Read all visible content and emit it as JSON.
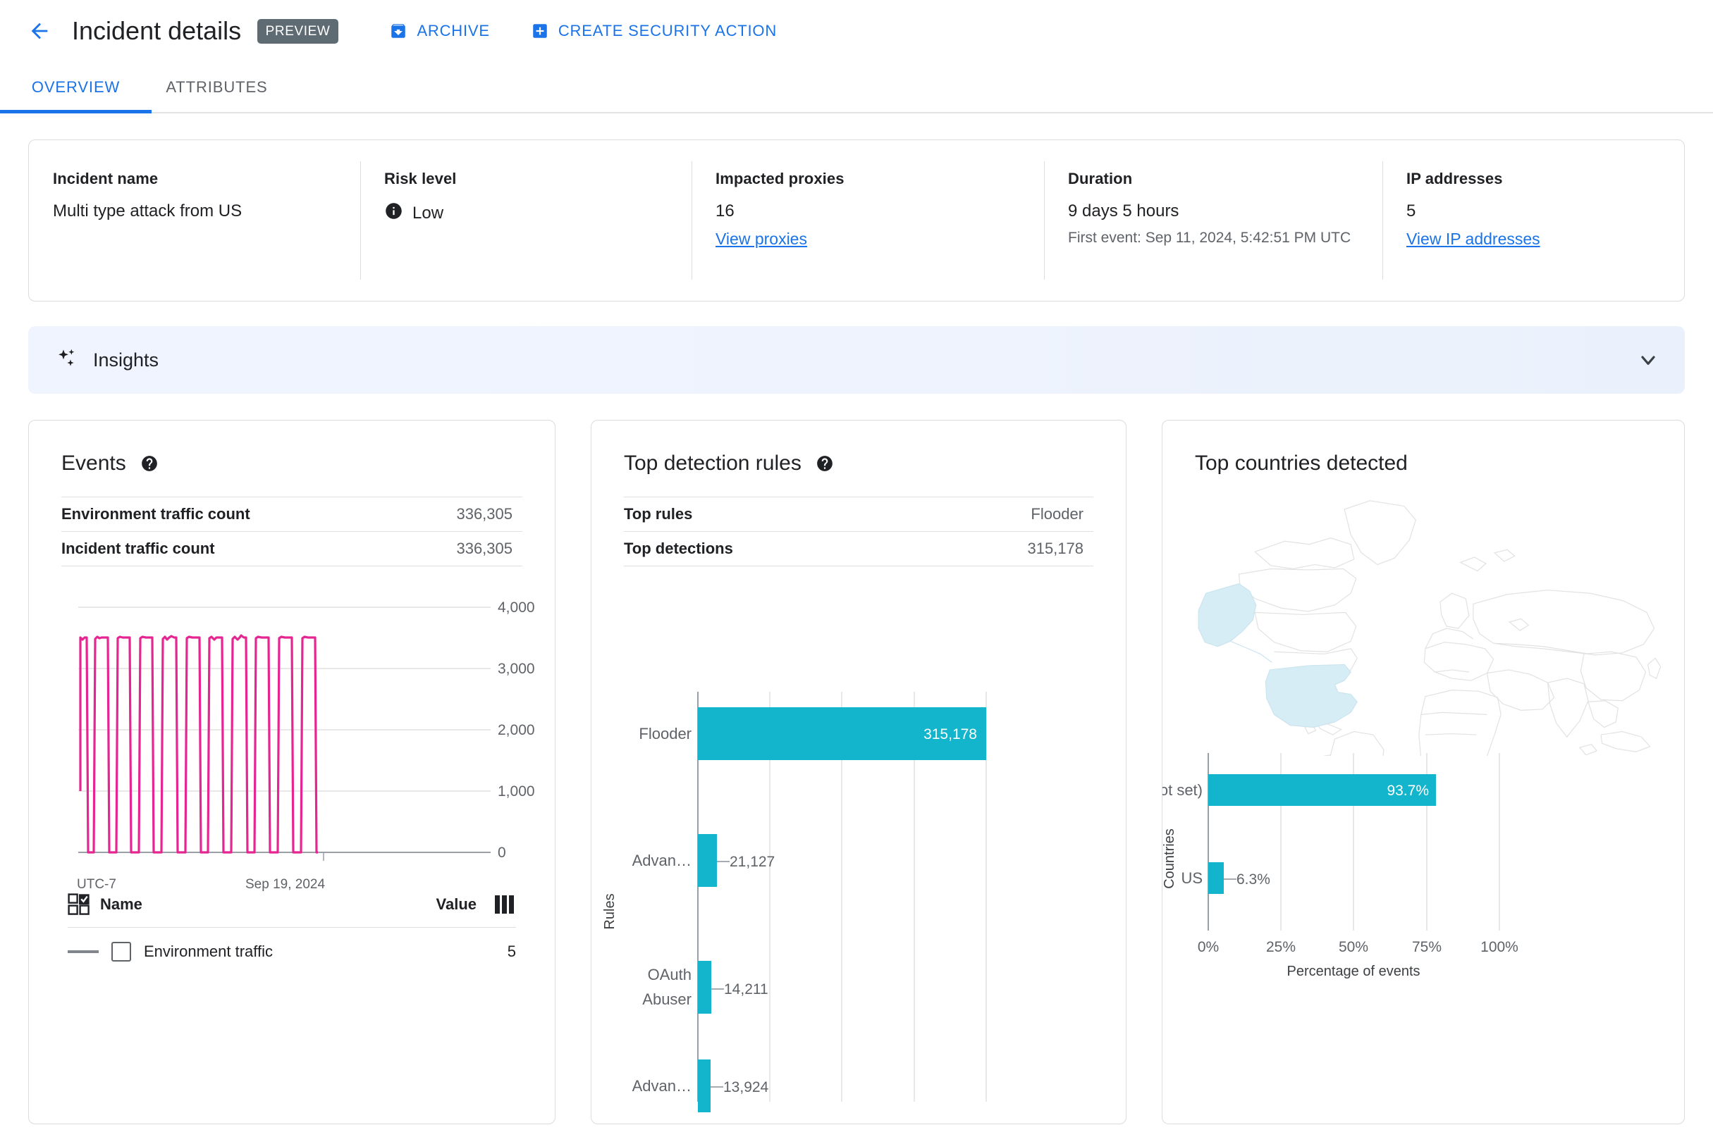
{
  "header": {
    "back_icon": "arrow-left-icon",
    "title": "Incident details",
    "preview_badge": "PREVIEW",
    "actions": [
      {
        "label": "ARCHIVE",
        "icon": "archive-icon"
      },
      {
        "label": "CREATE SECURITY ACTION",
        "icon": "plus-box-icon"
      }
    ]
  },
  "tabs": [
    {
      "label": "OVERVIEW",
      "active": true
    },
    {
      "label": "ATTRIBUTES",
      "active": false
    }
  ],
  "summary": {
    "incident_name": {
      "label": "Incident name",
      "value": "Multi type attack from US"
    },
    "risk_level": {
      "label": "Risk level",
      "value": "Low",
      "icon": "info-icon"
    },
    "impacted_proxies": {
      "label": "Impacted proxies",
      "value": "16",
      "link": "View proxies"
    },
    "duration": {
      "label": "Duration",
      "value": "9 days 5 hours",
      "sub": "First event: Sep 11, 2024, 5:42:51 PM UTC"
    },
    "ip_addresses": {
      "label": "IP addresses",
      "value": "5",
      "link": "View IP addresses"
    }
  },
  "insights": {
    "title": "Insights",
    "sparkle_icon": "sparkle-icon",
    "chevron_icon": "chevron-down-icon"
  },
  "events_card": {
    "title": "Events",
    "help_icon": "help-icon",
    "rows": [
      {
        "key": "Environment traffic count",
        "value": "336,305"
      },
      {
        "key": "Incident traffic count",
        "value": "336,305"
      }
    ],
    "legend": {
      "name_header": "Name",
      "value_header": "Value",
      "checkbox_icon": "select-all-icon",
      "columns_icon": "columns-icon",
      "rows": [
        {
          "name": "Environment traffic",
          "value": "5"
        }
      ]
    }
  },
  "rules_card": {
    "title": "Top detection rules",
    "help_icon": "help-icon",
    "rows": [
      {
        "key": "Top rules",
        "value": "Flooder"
      },
      {
        "key": "Top detections",
        "value": "315,178"
      }
    ]
  },
  "countries_card": {
    "title": "Top countries detected",
    "map_highlight_color": "#d7edf5",
    "map_base_color": "#e4e4e4"
  },
  "colors": {
    "accent_blue": "#1a73e8",
    "teal": "#12b5cb",
    "pink": "#e52592",
    "chip_gray": "#5f6b73"
  },
  "chart_data": [
    {
      "type": "line",
      "title": "Events",
      "xlabel": "",
      "ylabel": "",
      "ylim": [
        0,
        4000
      ],
      "ytick_labels": [
        "0",
        "1,000",
        "2,000",
        "3,000",
        "4,000"
      ],
      "yticks": [
        0,
        1000,
        2000,
        3000,
        4000
      ],
      "xtick_labels": [
        "UTC-7",
        "Sep 19, 2024"
      ],
      "grid": true,
      "series": [
        {
          "name": "Environment traffic",
          "color": "#e52592",
          "description": "Sawtooth: 10 cycles rising to ~3500 then dropping to 0",
          "peak_value": 3500,
          "trough_value": 0,
          "cycles": 10,
          "values": [
            1050,
            3500,
            3500,
            0,
            3450,
            3500,
            3480,
            3500,
            0,
            3460,
            3500,
            0,
            3440,
            3500,
            0,
            3450,
            3520,
            3500,
            0,
            3470,
            3500,
            0,
            3450,
            3480,
            3500,
            0,
            3440,
            3490,
            3500,
            0,
            3460,
            3500,
            0,
            3470,
            3500,
            0
          ]
        }
      ]
    },
    {
      "type": "bar",
      "orientation": "horizontal",
      "title": "Top detection rules",
      "xlabel": "",
      "ylabel": "Rules",
      "categories": [
        "Flooder",
        "Advan…",
        "OAuth Abuser",
        "Advan…"
      ],
      "values": [
        315178,
        21127,
        14211,
        13924
      ],
      "value_labels": [
        "315,178",
        "21,127",
        "14,211",
        "13,924"
      ],
      "bar_color": "#12b5cb",
      "xlim": [
        0,
        370000
      ],
      "grid": true
    },
    {
      "type": "bar",
      "orientation": "horizontal",
      "title": "Top countries detected",
      "xlabel": "Percentage of events",
      "ylabel": "Countries",
      "categories": [
        "(not set)",
        "US"
      ],
      "values": [
        93.7,
        6.3
      ],
      "value_labels": [
        "93.7%",
        "6.3%"
      ],
      "bar_color": "#12b5cb",
      "xlim": [
        0,
        100
      ],
      "xtick_labels": [
        "0%",
        "25%",
        "50%",
        "75%",
        "100%"
      ],
      "xticks": [
        0,
        25,
        50,
        75,
        100
      ],
      "grid": true
    }
  ]
}
